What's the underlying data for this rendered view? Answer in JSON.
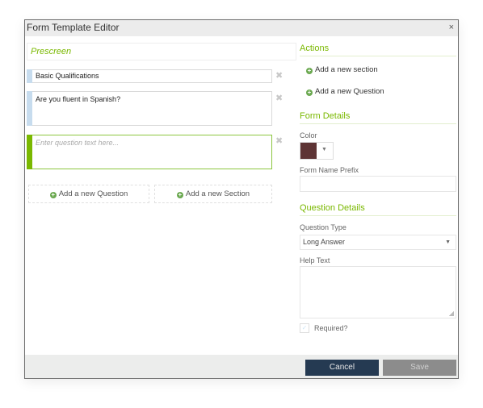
{
  "dialog": {
    "title": "Form Template Editor",
    "close_icon": "×"
  },
  "form": {
    "section_title": "Prescreen",
    "items": [
      {
        "text": "Basic Qualifications",
        "type": "section"
      },
      {
        "text": "Are you fluent in Spanish?",
        "type": "question"
      },
      {
        "placeholder": "Enter question text here...",
        "type": "question",
        "active": true
      }
    ],
    "delete_icon": "✖",
    "add_question_label": "Add a new Question",
    "add_section_label": "Add a new Section"
  },
  "sidebar": {
    "actions_title": "Actions",
    "add_section_link": "Add a new section",
    "add_question_link": "Add a new Question",
    "form_details_title": "Form Details",
    "color_label": "Color",
    "color_value": "#5e3435",
    "form_name_prefix_label": "Form Name Prefix",
    "form_name_prefix_value": "",
    "question_details_title": "Question Details",
    "question_type_label": "Question Type",
    "question_type_value": "Long Answer",
    "help_text_label": "Help Text",
    "help_text_value": "",
    "required_label": "Required?",
    "required_checked": false
  },
  "footer": {
    "cancel_label": "Cancel",
    "save_label": "Save"
  },
  "colors": {
    "accent": "#7ab800",
    "cancel_bg": "#253a52",
    "save_bg": "#8c8c8c"
  }
}
